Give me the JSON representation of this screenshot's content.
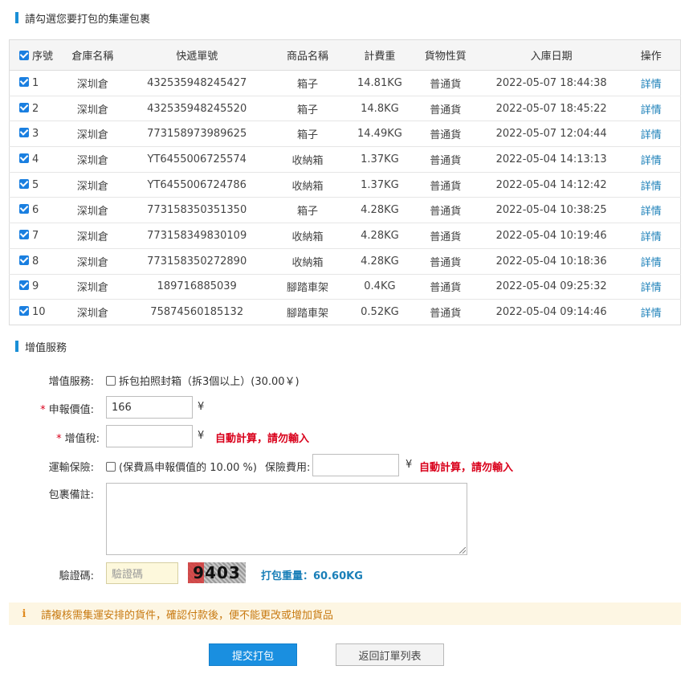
{
  "packages_section_title": "請勾選您要打包的集運包裹",
  "table": {
    "headers": {
      "seq": "序號",
      "warehouse": "倉庫名稱",
      "tracking": "快遞單號",
      "product": "商品名稱",
      "weight": "計費重",
      "cargo_type": "貨物性質",
      "date": "入庫日期",
      "action": "操作"
    },
    "rows": [
      {
        "seq": "1",
        "warehouse": "深圳倉",
        "tracking": "432535948245427",
        "product": "箱子",
        "weight": "14.81KG",
        "cargo_type": "普通貨",
        "date": "2022-05-07 18:44:38",
        "action": "詳情"
      },
      {
        "seq": "2",
        "warehouse": "深圳倉",
        "tracking": "432535948245520",
        "product": "箱子",
        "weight": "14.8KG",
        "cargo_type": "普通貨",
        "date": "2022-05-07 18:45:22",
        "action": "詳情"
      },
      {
        "seq": "3",
        "warehouse": "深圳倉",
        "tracking": "773158973989625",
        "product": "箱子",
        "weight": "14.49KG",
        "cargo_type": "普通貨",
        "date": "2022-05-07 12:04:44",
        "action": "詳情"
      },
      {
        "seq": "4",
        "warehouse": "深圳倉",
        "tracking": "YT6455006725574",
        "product": "收納箱",
        "weight": "1.37KG",
        "cargo_type": "普通貨",
        "date": "2022-05-04 14:13:13",
        "action": "詳情"
      },
      {
        "seq": "5",
        "warehouse": "深圳倉",
        "tracking": "YT6455006724786",
        "product": "收納箱",
        "weight": "1.37KG",
        "cargo_type": "普通貨",
        "date": "2022-05-04 14:12:42",
        "action": "詳情"
      },
      {
        "seq": "6",
        "warehouse": "深圳倉",
        "tracking": "773158350351350",
        "product": "箱子",
        "weight": "4.28KG",
        "cargo_type": "普通貨",
        "date": "2022-05-04 10:38:25",
        "action": "詳情"
      },
      {
        "seq": "7",
        "warehouse": "深圳倉",
        "tracking": "773158349830109",
        "product": "收納箱",
        "weight": "4.28KG",
        "cargo_type": "普通貨",
        "date": "2022-05-04 10:19:46",
        "action": "詳情"
      },
      {
        "seq": "8",
        "warehouse": "深圳倉",
        "tracking": "773158350272890",
        "product": "收納箱",
        "weight": "4.28KG",
        "cargo_type": "普通貨",
        "date": "2022-05-04 10:18:36",
        "action": "詳情"
      },
      {
        "seq": "9",
        "warehouse": "深圳倉",
        "tracking": "189716885039",
        "product": "腳踏車架",
        "weight": "0.4KG",
        "cargo_type": "普通貨",
        "date": "2022-05-04 09:25:32",
        "action": "詳情"
      },
      {
        "seq": "10",
        "warehouse": "深圳倉",
        "tracking": "75874560185132",
        "product": "腳踏車架",
        "weight": "0.52KG",
        "cargo_type": "普通貨",
        "date": "2022-05-04 09:14:46",
        "action": "詳情"
      }
    ]
  },
  "value_added_section_title": "增值服務",
  "form": {
    "service_label": "增值服務:",
    "service_option": "拆包拍照封箱（拆3個以上）(30.00￥)",
    "declared_value_label": "申報價值:",
    "declared_value": "166",
    "vat_label": "增值稅:",
    "vat_value": "",
    "currency": "¥",
    "auto_calc_note": "自動計算，請勿輸入",
    "insurance_label": "運輸保險:",
    "insurance_desc": "(保費爲申報價值的 10.00 %)",
    "insurance_fee_label": "保險費用:",
    "insurance_fee_value": "",
    "remark_label": "包裹備註:",
    "captcha_label": "驗證碼:",
    "captcha_placeholder": "驗證碼",
    "captcha_code": "9403",
    "pack_weight": "打包重量：60.60KG"
  },
  "notice": {
    "icon": "info-icon",
    "text": "請複核需集運安排的貨件，確認付款後，便不能更改或增加貨品"
  },
  "buttons": {
    "submit": "提交打包",
    "back": "返回訂單列表"
  },
  "colors": {
    "accent": "#1a8fe0",
    "warning_red": "#d9001b",
    "notice_bg": "#fdf6e3"
  }
}
